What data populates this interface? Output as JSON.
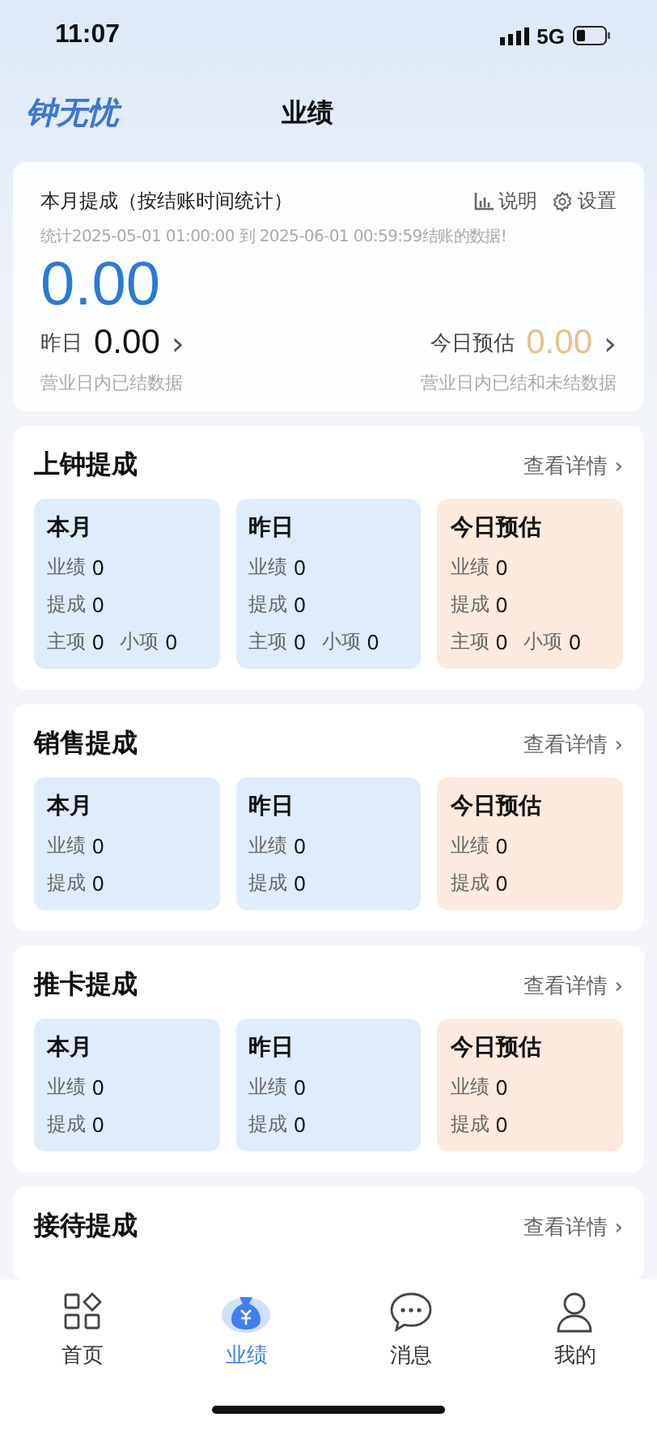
{
  "status_bar": {
    "time": "11:07",
    "network": "5G"
  },
  "header": {
    "logo": "钟无忧",
    "title": "业绩"
  },
  "summary": {
    "title": "本月提成（按结账时间统计）",
    "help": "说明",
    "settings": "设置",
    "period": "统计2025-05-01 01:00:00 到 2025-06-01 00:59:59结账的数据!",
    "amount": "0.00",
    "left": {
      "label": "昨日",
      "value": "0.00",
      "arrow": "›",
      "note": "营业日内已结数据"
    },
    "right": {
      "label": "今日预估",
      "value": "0.00",
      "arrow": "›",
      "note": "营业日内已结和未结数据"
    }
  },
  "sections": [
    {
      "title": "上钟提成",
      "link": "查看详情 ›",
      "cards": [
        {
          "title": "本月",
          "color": "#dfecfb",
          "lines": [
            [
              {
                "label": "业绩",
                "value": "0"
              }
            ],
            [
              {
                "label": "提成",
                "value": "0"
              }
            ],
            [
              {
                "label": "主项",
                "value": "0"
              },
              {
                "label": "小项",
                "value": "0"
              }
            ]
          ]
        },
        {
          "title": "昨日",
          "color": "#dfecfb",
          "lines": [
            [
              {
                "label": "业绩",
                "value": "0"
              }
            ],
            [
              {
                "label": "提成",
                "value": "0"
              }
            ],
            [
              {
                "label": "主项",
                "value": "0"
              },
              {
                "label": "小项",
                "value": "0"
              }
            ]
          ]
        },
        {
          "title": "今日预估",
          "color": "#fdeade",
          "lines": [
            [
              {
                "label": "业绩",
                "value": "0"
              }
            ],
            [
              {
                "label": "提成",
                "value": "0"
              }
            ],
            [
              {
                "label": "主项",
                "value": "0"
              },
              {
                "label": "小项",
                "value": "0"
              }
            ]
          ]
        }
      ]
    },
    {
      "title": "销售提成",
      "link": "查看详情 ›",
      "cards": [
        {
          "title": "本月",
          "color": "#dfecfb",
          "lines": [
            [
              {
                "label": "业绩",
                "value": "0"
              }
            ],
            [
              {
                "label": "提成",
                "value": "0"
              }
            ]
          ]
        },
        {
          "title": "昨日",
          "color": "#dfecfb",
          "lines": [
            [
              {
                "label": "业绩",
                "value": "0"
              }
            ],
            [
              {
                "label": "提成",
                "value": "0"
              }
            ]
          ]
        },
        {
          "title": "今日预估",
          "color": "#fdeade",
          "lines": [
            [
              {
                "label": "业绩",
                "value": "0"
              }
            ],
            [
              {
                "label": "提成",
                "value": "0"
              }
            ]
          ]
        }
      ]
    },
    {
      "title": "推卡提成",
      "link": "查看详情 ›",
      "cards": [
        {
          "title": "本月",
          "color": "#dfecfb",
          "lines": [
            [
              {
                "label": "业绩",
                "value": "0"
              }
            ],
            [
              {
                "label": "提成",
                "value": "0"
              }
            ]
          ]
        },
        {
          "title": "昨日",
          "color": "#dfecfb",
          "lines": [
            [
              {
                "label": "业绩",
                "value": "0"
              }
            ],
            [
              {
                "label": "提成",
                "value": "0"
              }
            ]
          ]
        },
        {
          "title": "今日预估",
          "color": "#fdeade",
          "lines": [
            [
              {
                "label": "业绩",
                "value": "0"
              }
            ],
            [
              {
                "label": "提成",
                "value": "0"
              }
            ]
          ]
        }
      ]
    },
    {
      "title": "接待提成",
      "link": "查看详情 ›"
    }
  ],
  "tabs": [
    {
      "label": "首页",
      "kind": "home",
      "selected": false
    },
    {
      "label": "业绩",
      "kind": "money",
      "selected": true
    },
    {
      "label": "消息",
      "kind": "chat",
      "selected": false
    },
    {
      "label": "我的",
      "kind": "user",
      "selected": false
    }
  ]
}
